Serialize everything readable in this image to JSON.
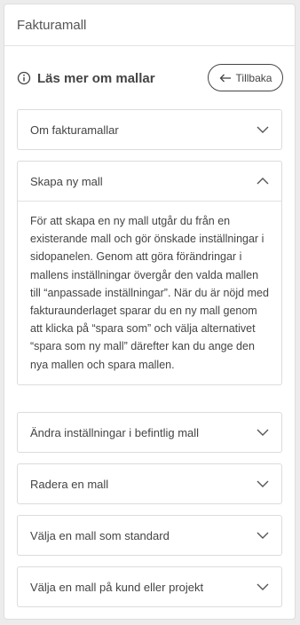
{
  "panel": {
    "title": "Fakturamall"
  },
  "subheader": {
    "title": "Läs mer om mallar",
    "back_label": "Tillbaka"
  },
  "accordion": [
    {
      "title": "Om fakturamallar",
      "expanded": false
    },
    {
      "title": "Skapa ny mall",
      "expanded": true,
      "body": "För att skapa en ny mall utgår du från en existerande mall och gör önskade inställningar i sidopanelen. Genom att göra förändringar i mallens inställningar övergår den valda mallen till “anpassade inställningar”. När du är nöjd med fakturaunderlaget sparar du en ny mall genom att klicka på “spara som” och välja alternativet “spara som ny mall” därefter kan du ange den nya mallen och spara mallen."
    },
    {
      "title": "Ändra inställningar i befintlig mall",
      "expanded": false
    },
    {
      "title": "Radera en mall",
      "expanded": false
    },
    {
      "title": "Välja en mall som standard",
      "expanded": false
    },
    {
      "title": "Välja en mall på kund eller projekt",
      "expanded": false
    }
  ]
}
